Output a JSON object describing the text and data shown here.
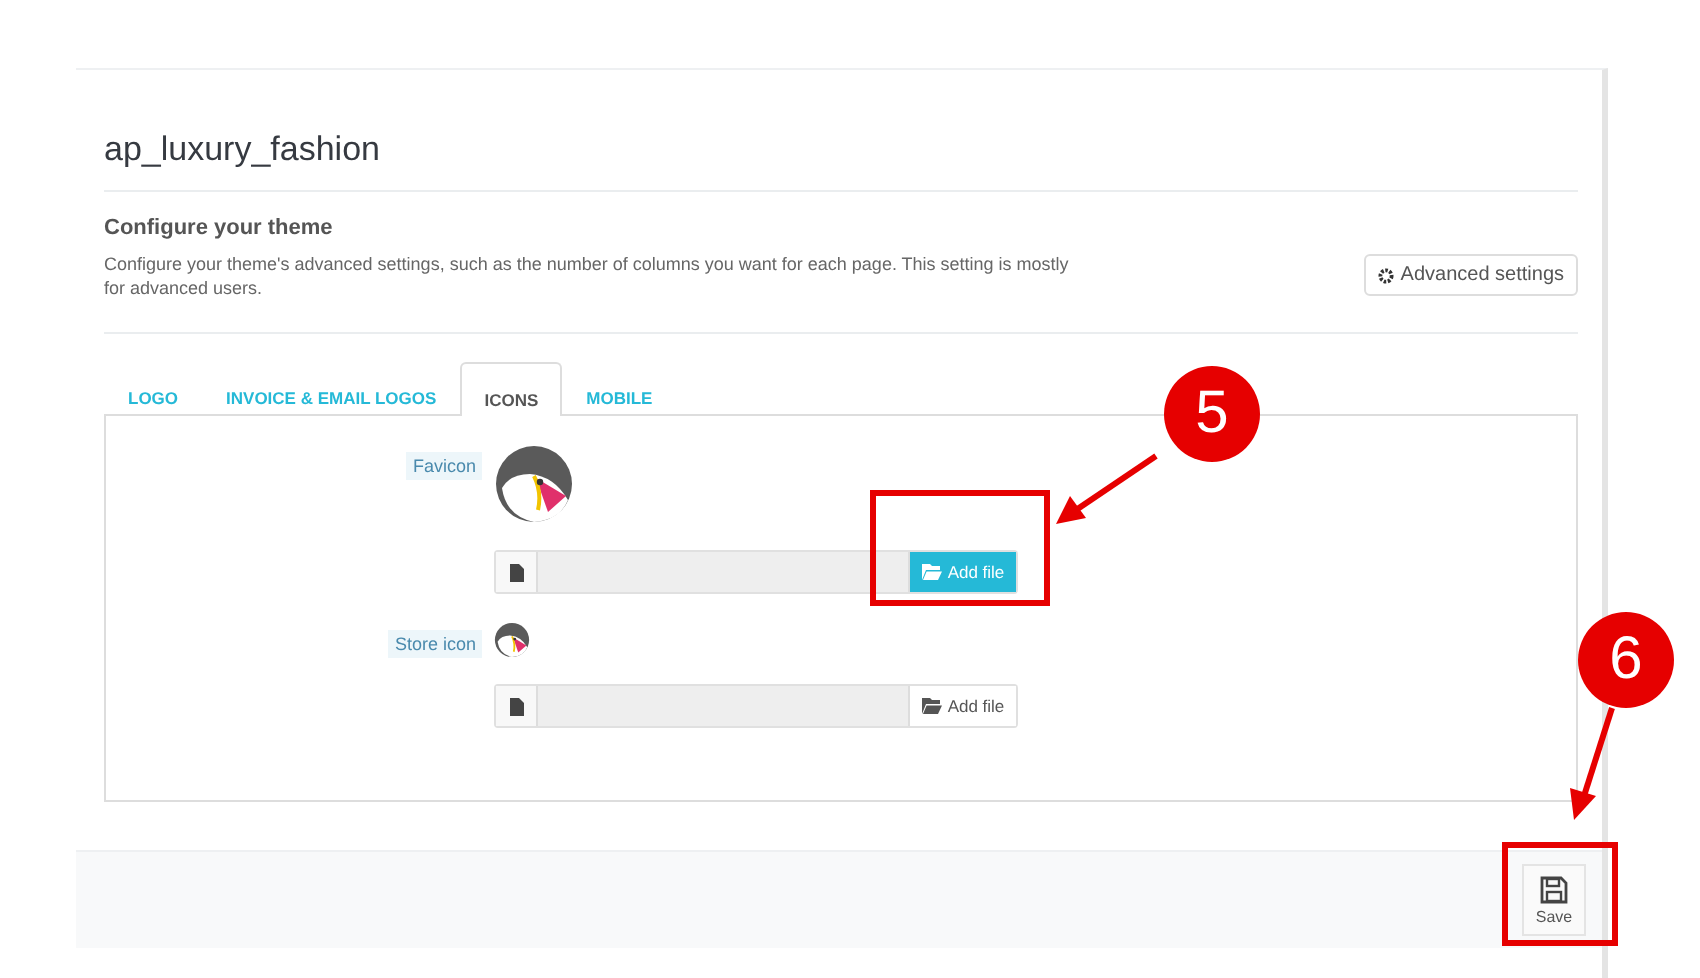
{
  "page_title": "ap_luxury_fashion",
  "section": {
    "title": "Configure your theme",
    "description": "Configure your theme's advanced settings, such as the number of columns you want for each page. This setting is mostly for advanced users.",
    "button": "Advanced settings"
  },
  "tabs": [
    {
      "label": "LOGO",
      "selected": false
    },
    {
      "label": "INVOICE & EMAIL LOGOS",
      "selected": false
    },
    {
      "label": "ICONS",
      "selected": true
    },
    {
      "label": "MOBILE",
      "selected": false
    }
  ],
  "fields": [
    {
      "label": "Favicon",
      "kind": "large",
      "button": "Add file",
      "highlighted": true
    },
    {
      "label": "Store icon",
      "kind": "small",
      "button": "Add file",
      "highlighted": false
    }
  ],
  "footer": {
    "save_button": "Save"
  },
  "annotations": [
    {
      "number": "5"
    },
    {
      "number": "6"
    }
  ]
}
